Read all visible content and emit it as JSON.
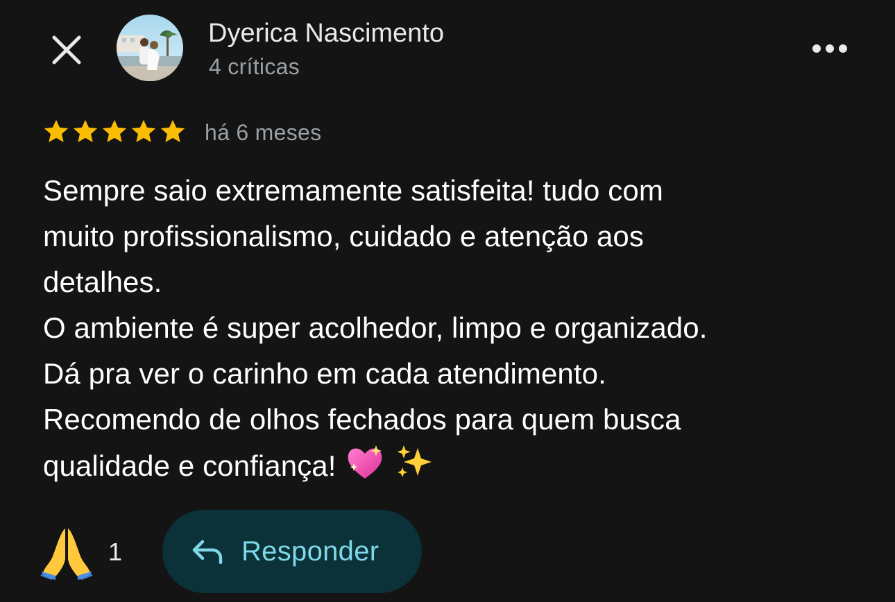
{
  "header": {
    "author_name": "Dyerica Nascimento",
    "review_count": "4 críticas",
    "close_icon": "close-icon",
    "more_icon": "more-horizontal-icon"
  },
  "review": {
    "rating": 5,
    "max_rating": 5,
    "date": "há 6 meses",
    "text": "Sempre saio extremamente satisfeita!  tudo com\nmuito profissionalismo, cuidado e atenção aos\ndetalhes.\nO ambiente é super acolhedor, limpo e organizado.\nDá pra ver o carinho em cada atendimento.\nRecomendo de olhos fechados para quem busca\nqualidade e confiança!",
    "trailing_emojis": [
      "sparkling-heart-emoji",
      "sparkles-emoji"
    ]
  },
  "actions": {
    "reaction_icon": "folded-hands-emoji",
    "reaction_count": "1",
    "reply_label": "Responder",
    "reply_icon": "reply-arrow-icon"
  },
  "colors": {
    "background": "#141414",
    "star": "#fbbc04",
    "reply_button_bg": "#0a3238",
    "reply_button_text": "#7fd8e8",
    "secondary_text": "#9aa0a6"
  }
}
